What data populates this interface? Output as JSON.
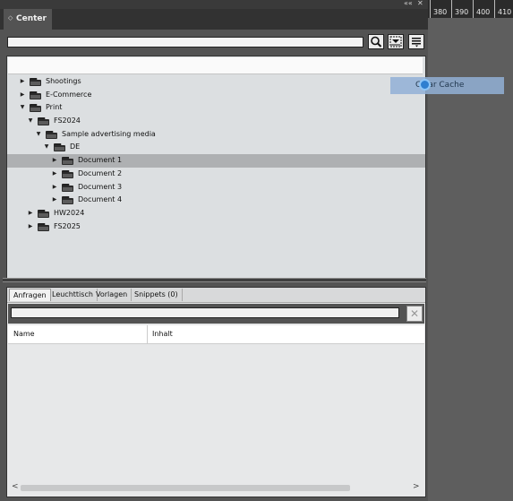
{
  "panel": {
    "title": "Center",
    "controls": [
      "««",
      "✕"
    ]
  },
  "ruler": [
    "380",
    "390",
    "400",
    "410"
  ],
  "tree": [
    {
      "label": "Shootings",
      "level": 0,
      "expanded": false,
      "selected": false
    },
    {
      "label": "E-Commerce",
      "level": 0,
      "expanded": false,
      "selected": false
    },
    {
      "label": "Print",
      "level": 0,
      "expanded": true,
      "selected": false
    },
    {
      "label": "FS2024",
      "level": 1,
      "expanded": true,
      "selected": false
    },
    {
      "label": "Sample advertising media",
      "level": 2,
      "expanded": true,
      "selected": false
    },
    {
      "label": "DE",
      "level": 3,
      "expanded": true,
      "selected": false
    },
    {
      "label": "Document 1",
      "level": 4,
      "expanded": false,
      "selected": true
    },
    {
      "label": "Document 2",
      "level": 4,
      "expanded": false,
      "selected": false
    },
    {
      "label": "Document 3",
      "level": 4,
      "expanded": false,
      "selected": false
    },
    {
      "label": "Document 4",
      "level": 4,
      "expanded": false,
      "selected": false
    },
    {
      "label": "HW2024",
      "level": 1,
      "expanded": false,
      "selected": false
    },
    {
      "label": "FS2025",
      "level": 1,
      "expanded": false,
      "selected": false
    }
  ],
  "drag_item": {
    "label": "Clear Cache"
  },
  "tabs": [
    "Anfragen",
    "Leuchttisch",
    "Vorlagen",
    "Snippets (0)"
  ],
  "table": {
    "columns": [
      "Name",
      "Inhalt"
    ]
  },
  "icons": {
    "search": "search-icon",
    "layout": "layout-toggle-icon",
    "menu": "menu-icon",
    "folder": "folder-icon",
    "clear": "close-icon"
  },
  "colors": {
    "panel_bg": "#535353",
    "tree_bg": "#dcdfe1",
    "selected_row": "#aeb0b2",
    "drag_ghost": "#92b0d6"
  }
}
